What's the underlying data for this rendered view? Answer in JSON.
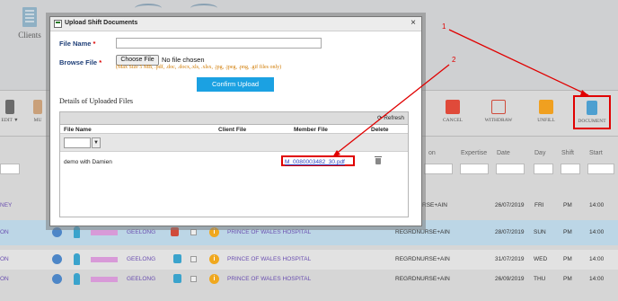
{
  "background": {
    "clients_label": "Clients",
    "toolbar": {
      "edit_label": "EDIT ▼",
      "mu_label": "MU",
      "cancel_label": "CANCEL",
      "withdraw_label": "WITHDRAW",
      "unfill_label": "UNFILL",
      "document_label": "DOCUMENT"
    },
    "columns": [
      "on",
      "Expertise",
      "Date",
      "Day",
      "Shift",
      "Start"
    ],
    "rows": [
      {
        "left": "NEY",
        "location": "",
        "hospital": "",
        "expertise": "",
        "date": "",
        "day": "",
        "shift": "",
        "start": ""
      },
      {
        "left": "ON",
        "location": "GEELONG",
        "hospital": "PRINCE OF WALES HOSPITAL",
        "expertise": "REGRDNURSE+AIN",
        "date": "28/07/2019",
        "day": "SUN",
        "shift": "PM",
        "start": "14:00"
      },
      {
        "left": "ON",
        "location": "GEELONG",
        "hospital": "PRINCE OF WALES HOSPITAL",
        "expertise": "REGRDNURSE+AIN",
        "date": "31/07/2019",
        "day": "WED",
        "shift": "PM",
        "start": "14:00"
      },
      {
        "left": "ON",
        "location": "GEELONG",
        "hospital": "PRINCE OF WALES HOSPITAL",
        "expertise": "REGRDNURSE+AIN",
        "date": "26/09/2019",
        "day": "THU",
        "shift": "PM",
        "start": "14:00"
      }
    ],
    "partial_row": {
      "expertise": "RSE+AIN",
      "date": "26/07/2019",
      "day": "FRI",
      "shift": "PM",
      "start": "14:00"
    }
  },
  "dialog": {
    "title": "Upload Shift Documents",
    "close_glyph": "×",
    "file_name_label": "File Name",
    "browse_file_label": "Browse File",
    "required_marker": "*",
    "file_name_value": "",
    "choose_file_label": "Choose File",
    "no_file_text": "No file chosen",
    "max_size_note": "(Max Size 5 MB, .pdf, .doc, .docx,.xls, .xlsx, .jpg, .jpeg, .png, .gif files only)",
    "confirm_label": "Confirm Upload",
    "details_heading": "Details of Uploaded Files",
    "refresh_label": "Refresh",
    "grid_headers": {
      "file_name": "File Name",
      "client_file": "Client File",
      "member_file": "Member File",
      "delete": "Delete"
    },
    "filter_value": "",
    "rows": [
      {
        "file_name": "demo with Damien",
        "client_file": "",
        "member_file": "M_0080003482_30.pdf"
      }
    ]
  },
  "annotations": {
    "marker_1": "1",
    "marker_2": "2",
    "color": "#e00000"
  }
}
